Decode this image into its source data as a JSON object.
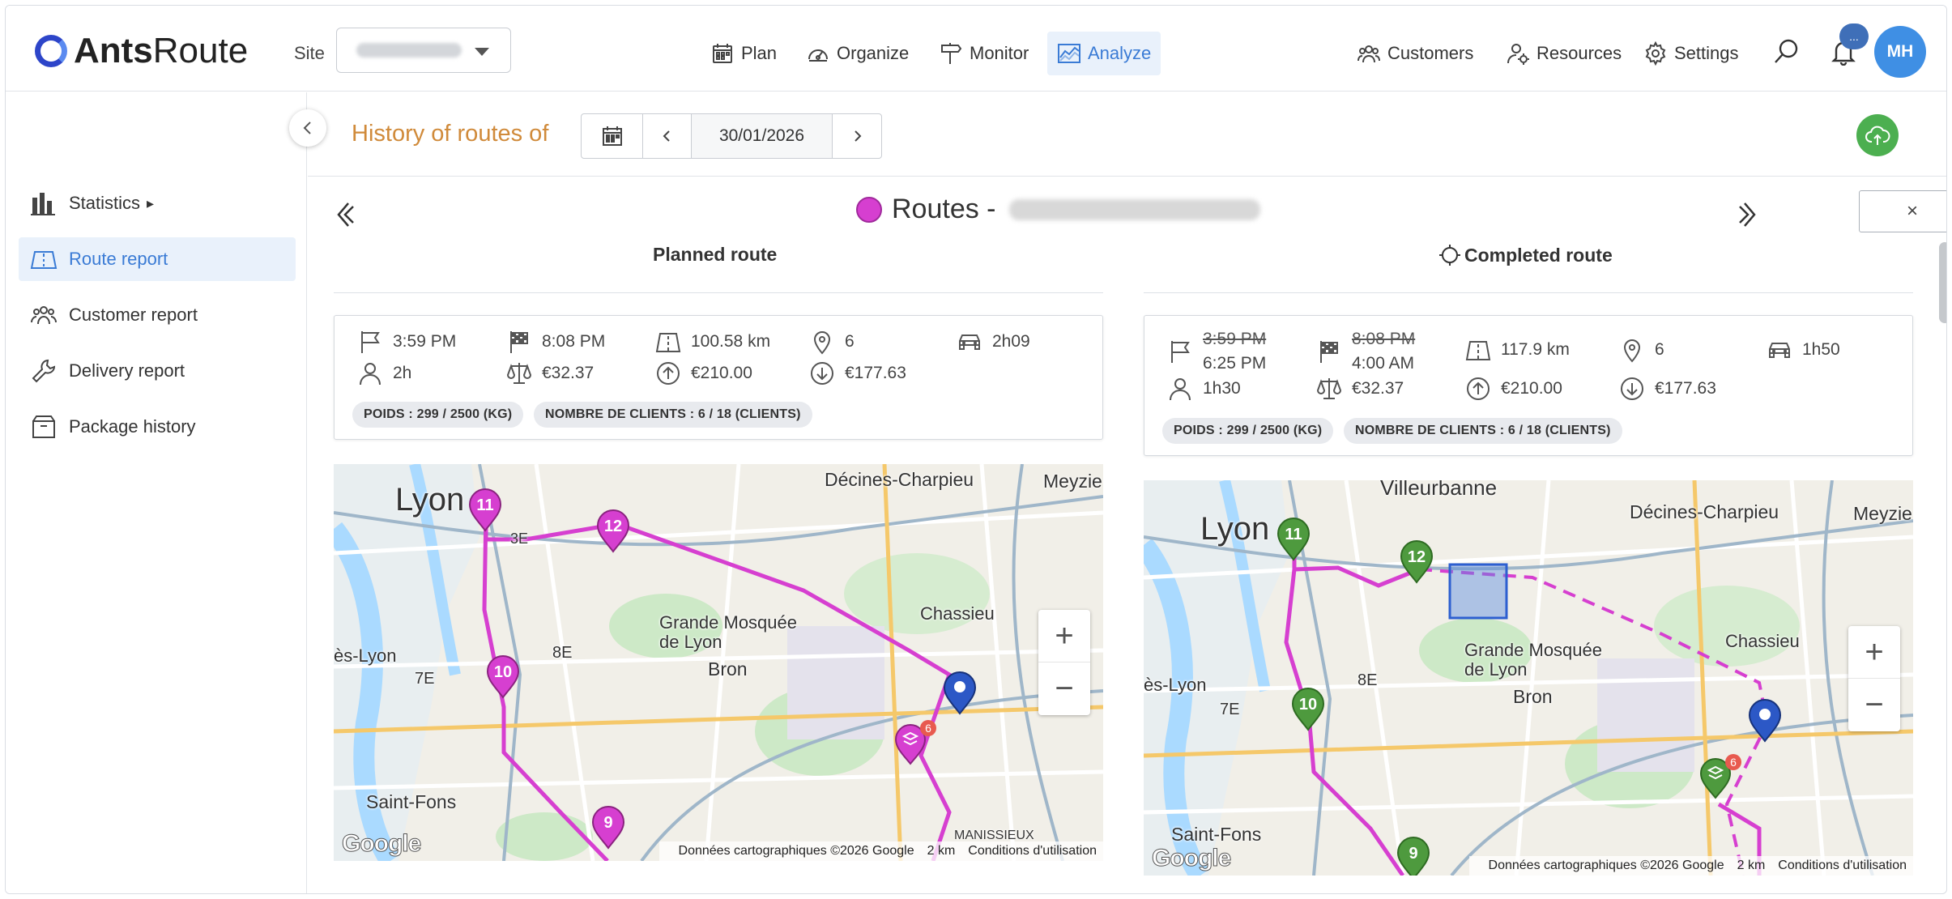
{
  "header": {
    "logo_text_bold": "Ants",
    "logo_text": "Route",
    "site_label": "Site",
    "nav": [
      {
        "label": "Plan",
        "icon": "calendar-icon"
      },
      {
        "label": "Organize",
        "icon": "gauge-icon"
      },
      {
        "label": "Monitor",
        "icon": "signpost-icon"
      },
      {
        "label": "Analyze",
        "icon": "chart-line-icon",
        "active": true
      }
    ],
    "right_nav": [
      {
        "label": "Customers",
        "icon": "users-icon"
      },
      {
        "label": "Resources",
        "icon": "user-gear-icon"
      },
      {
        "label": "Settings",
        "icon": "gear-icon"
      }
    ],
    "notification_badge": "...",
    "avatar_initials": "MH"
  },
  "sidebar": {
    "items": [
      {
        "label": "Statistics",
        "suffix": "▸"
      },
      {
        "label": "Route report",
        "active": true
      },
      {
        "label": "Customer report"
      },
      {
        "label": "Delivery report"
      },
      {
        "label": "Package history"
      }
    ]
  },
  "toolbar": {
    "history_title": "History of routes of",
    "date": "30/01/2026"
  },
  "route": {
    "title_prefix": "Routes -",
    "close_label": "×",
    "dot_color": "#d63fd0"
  },
  "planned": {
    "title": "Planned route",
    "start": "3:59 PM",
    "end": "8:08 PM",
    "distance": "100.58 km",
    "stops": "6",
    "drive_time": "2h09",
    "duration": "2h",
    "cost": "€32.37",
    "revenue": "€210.00",
    "margin": "€177.63",
    "chip_weight": "POIDS : 299 / 2500 (KG)",
    "chip_clients": "NOMBRE DE CLIENTS : 6 / 18 (CLIENTS)"
  },
  "completed": {
    "title": "Completed route",
    "start_planned": "3:59 PM",
    "start_actual": "6:25 PM",
    "end_planned": "8:08 PM",
    "end_actual": "4:00 AM",
    "distance": "117.9 km",
    "stops": "6",
    "drive_time": "1h50",
    "duration": "1h30",
    "cost": "€32.37",
    "revenue": "€210.00",
    "margin": "€177.63",
    "chip_weight": "POIDS : 299 / 2500 (KG)",
    "chip_clients": "NOMBRE DE CLIENTS : 6 / 18 (CLIENTS)"
  },
  "map": {
    "labels": {
      "lyon": "Lyon",
      "villeurbanne": "Villeurbanne",
      "decines": "Décines-Charpieu",
      "meyzieu": "Meyzie",
      "chassieu": "Chassieu",
      "bron": "Bron",
      "mosque": "Grande Mosquée de Lyon",
      "saint_fons": "Saint-Fons",
      "venissieux": "ès-Lyon",
      "arr7": "7E",
      "arr8": "8E",
      "arr3": "3E",
      "manissieux": "MANISSIEUX"
    },
    "markers_planned": [
      "11",
      "12",
      "10",
      "9"
    ],
    "markers_completed": [
      "11",
      "12",
      "10",
      "9"
    ],
    "cluster_badge": "6",
    "zoom_in": "+",
    "zoom_out": "−",
    "attribution": "Données cartographiques ©2026 Google",
    "scale": "2 km",
    "terms": "Conditions d'utilisation",
    "google": "Google",
    "route_color": "#d63fd0",
    "completed_marker_color": "#4e9a3e"
  }
}
